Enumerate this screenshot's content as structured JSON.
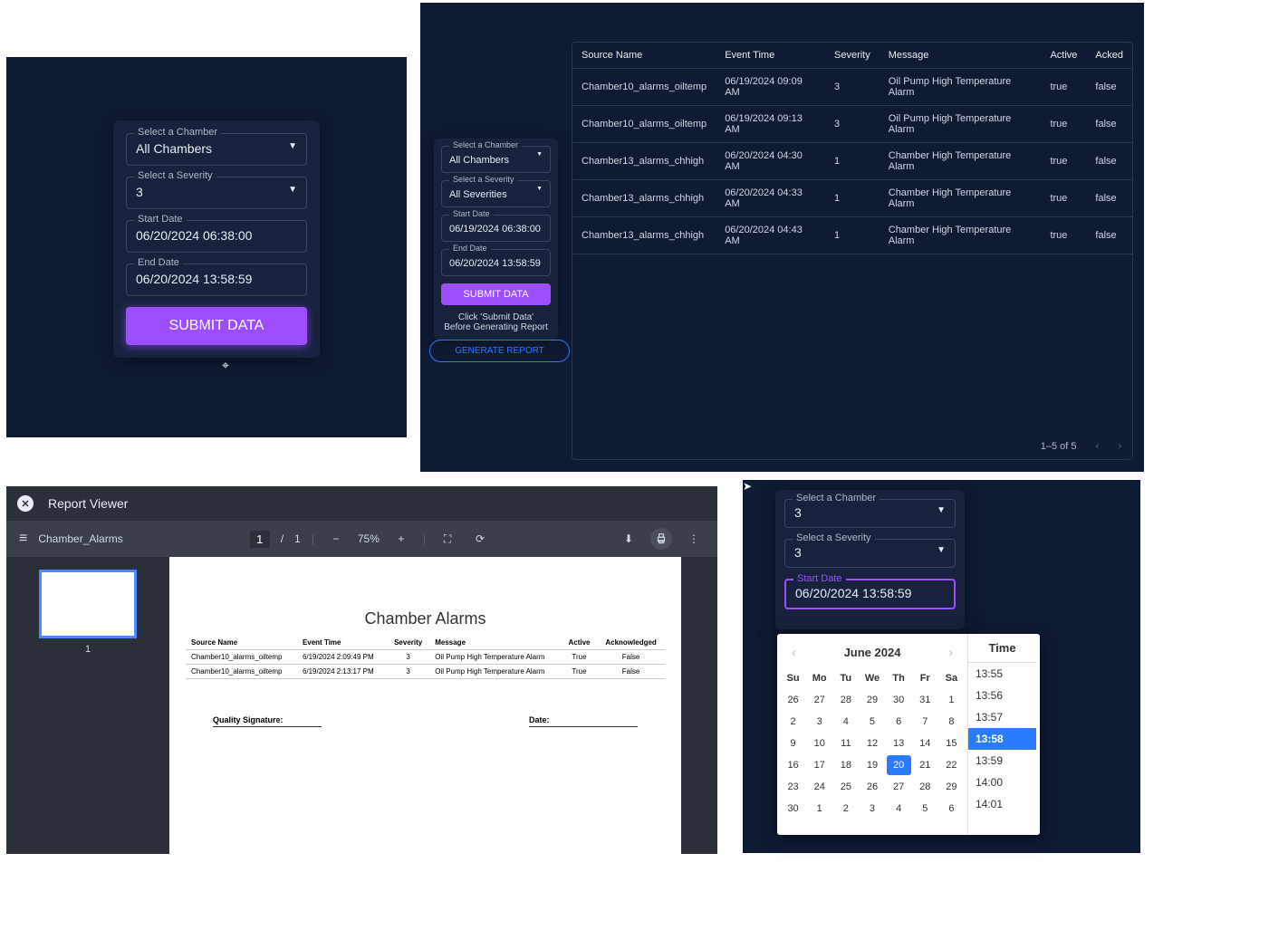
{
  "panel1": {
    "chamber_label": "Select a Chamber",
    "chamber_value": "All Chambers",
    "severity_label": "Select a Severity",
    "severity_value": "3",
    "start_date_label": "Start Date",
    "start_date_value": "06/20/2024 06:38:00",
    "end_date_label": "End Date",
    "end_date_value": "06/20/2024 13:58:59",
    "submit_label": "SUBMIT DATA"
  },
  "panel2": {
    "chamber_label": "Select a Chamber",
    "chamber_value": "All Chambers",
    "severity_label": "Select a Severity",
    "severity_value": "All Severities",
    "start_date_label": "Start Date",
    "start_date_value": "06/19/2024 06:38:00",
    "end_date_label": "End Date",
    "end_date_value": "06/20/2024 13:58:59",
    "submit_label": "SUBMIT DATA",
    "hint1": "Click 'Submit Data'",
    "hint2": "Before Generating Report",
    "generate_report_label": "GENERATE REPORT",
    "columns": [
      "Source Name",
      "Event Time",
      "Severity",
      "Message",
      "Active",
      "Acked"
    ],
    "rows": [
      {
        "source": "Chamber10_alarms_oiltemp",
        "time": "06/19/2024 09:09 AM",
        "severity": "3",
        "message": "Oil Pump High Temperature Alarm",
        "active": "true",
        "acked": "false"
      },
      {
        "source": "Chamber10_alarms_oiltemp",
        "time": "06/19/2024 09:13 AM",
        "severity": "3",
        "message": "Oil Pump High Temperature Alarm",
        "active": "true",
        "acked": "false"
      },
      {
        "source": "Chamber13_alarms_chhigh",
        "time": "06/20/2024 04:30 AM",
        "severity": "1",
        "message": "Chamber High Temperature Alarm",
        "active": "true",
        "acked": "false"
      },
      {
        "source": "Chamber13_alarms_chhigh",
        "time": "06/20/2024 04:33 AM",
        "severity": "1",
        "message": "Chamber High Temperature Alarm",
        "active": "true",
        "acked": "false"
      },
      {
        "source": "Chamber13_alarms_chhigh",
        "time": "06/20/2024 04:43 AM",
        "severity": "1",
        "message": "Chamber High Temperature Alarm",
        "active": "true",
        "acked": "false"
      }
    ],
    "footer_text": "1–5 of 5"
  },
  "panel3": {
    "viewer_title": "Report Viewer",
    "file_name": "Chamber_Alarms",
    "page_current": "1",
    "page_sep": "/",
    "page_total": "1",
    "zoom": "75%",
    "thumb_page": "1",
    "report_title": "Chamber Alarms",
    "columns": [
      "Source Name",
      "Event Time",
      "Severity",
      "Message",
      "Active",
      "Acknowledged"
    ],
    "rows": [
      {
        "source": "Chamber10_alarms_oiltemp",
        "time": "6/19/2024 2:09:49 PM",
        "severity": "3",
        "message": "Oil Pump High Temperature Alarm",
        "active": "True",
        "ack": "False"
      },
      {
        "source": "Chamber10_alarms_oiltemp",
        "time": "6/19/2024 2:13:17 PM",
        "severity": "3",
        "message": "Oil Pump High Temperature Alarm",
        "active": "True",
        "ack": "False"
      }
    ],
    "sig_label": "Quality Signature:",
    "date_label": "Date:"
  },
  "panel4": {
    "chamber_label": "Select a Chamber",
    "chamber_value": "3",
    "severity_label": "Select a Severity",
    "severity_value": "3",
    "start_date_label": "Start Date",
    "start_date_value": "06/20/2024 13:58:59",
    "month_title": "June 2024",
    "time_title": "Time",
    "dow": [
      "Su",
      "Mo",
      "Tu",
      "We",
      "Th",
      "Fr",
      "Sa"
    ],
    "weeks": [
      [
        "26",
        "27",
        "28",
        "29",
        "30",
        "31",
        "1"
      ],
      [
        "2",
        "3",
        "4",
        "5",
        "6",
        "7",
        "8"
      ],
      [
        "9",
        "10",
        "11",
        "12",
        "13",
        "14",
        "15"
      ],
      [
        "16",
        "17",
        "18",
        "19",
        "20",
        "21",
        "22"
      ],
      [
        "23",
        "24",
        "25",
        "26",
        "27",
        "28",
        "29"
      ],
      [
        "30",
        "1",
        "2",
        "3",
        "4",
        "5",
        "6"
      ]
    ],
    "selected_day": "20",
    "times": [
      "13:55",
      "13:56",
      "13:57",
      "13:58",
      "13:59",
      "14:00",
      "14:01"
    ],
    "selected_time": "13:58"
  }
}
